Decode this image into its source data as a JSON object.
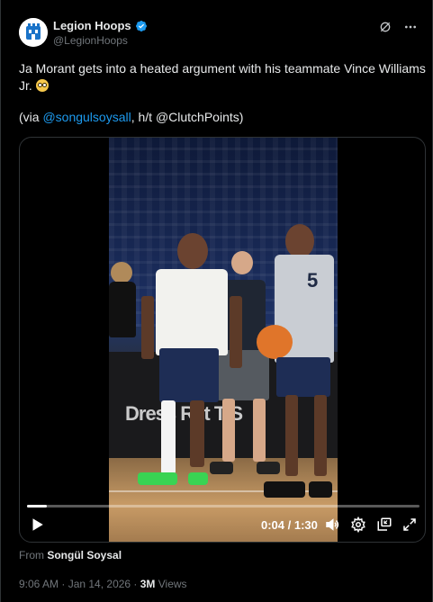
{
  "author": {
    "display_name": "Legion Hoops",
    "handle": "@LegionHoops",
    "avatar_icon": "legion-hoops-logo",
    "verified_icon": "verified-badge-icon"
  },
  "header_actions": {
    "grok_icon": "grok-icon",
    "more_icon": "more-options-icon"
  },
  "tweet": {
    "text": "Ja Morant gets into a heated argument with his teammate Vince Williams Jr.",
    "emoji": "flushed-face-emoji",
    "via_prefix": "(via ",
    "via_link": "@songulsoysall",
    "via_suffix": ", h/t @ClutchPoints)"
  },
  "video": {
    "banner_text": "Dress  Ret      T  S",
    "jersey_number": "5",
    "progress": 0.05,
    "time_display": "0:04 / 1:30",
    "controls": {
      "play_icon": "play-icon",
      "volume_icon": "volume-icon",
      "settings_icon": "settings-gear-icon",
      "pip_icon": "picture-in-picture-icon",
      "fullscreen_icon": "fullscreen-icon"
    }
  },
  "footer": {
    "from_label": "From",
    "from_name": "Songül Soysal",
    "timestamp": "9:06 AM · Jan 14, 2026 · ",
    "views_count": "3M",
    "views_label": " Views"
  },
  "colors": {
    "background": "#000000",
    "link": "#1d9bf0",
    "secondary_text": "#71767b",
    "border": "#2f3336"
  }
}
